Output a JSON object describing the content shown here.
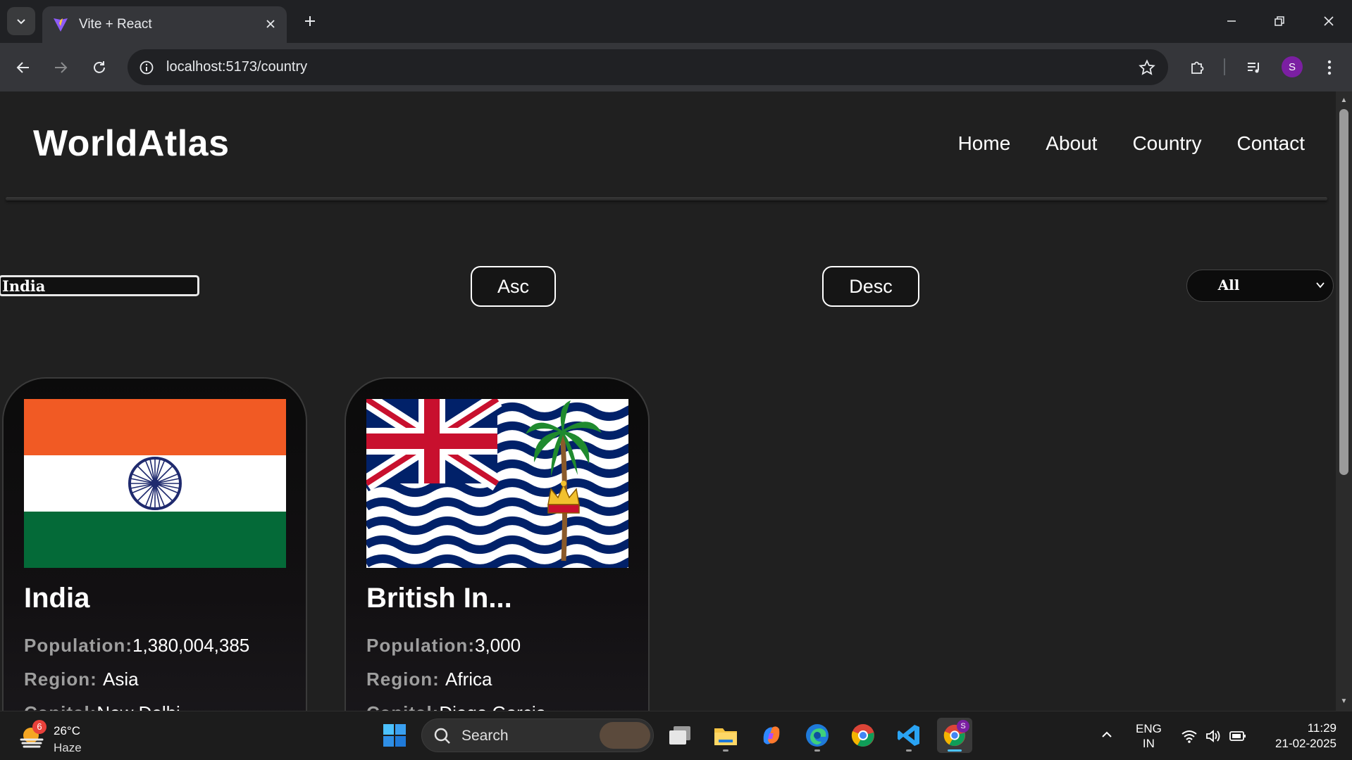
{
  "browser": {
    "tab_title": "Vite + React",
    "url": "localhost:5173/country",
    "profile_initial": "S"
  },
  "site": {
    "logo": "WorldAtlas",
    "nav": [
      "Home",
      "About",
      "Country",
      "Contact"
    ]
  },
  "controls": {
    "search_value": "India",
    "asc_label": "Asc",
    "desc_label": "Desc",
    "region_selected": "All"
  },
  "labels": {
    "population": "Population:",
    "region": "Region: ",
    "capital": "Capital:"
  },
  "countries": [
    {
      "name": "India",
      "flag": "india-flag",
      "population": "1,380,004,385",
      "region": "Asia",
      "capital": "New Delhi"
    },
    {
      "name": "British In...",
      "flag": "british-indian-ocean-territory-flag",
      "population": "3,000",
      "region": "Africa",
      "capital": "Diego Garcia"
    }
  ],
  "taskbar": {
    "weather_temp": "26°C",
    "weather_cond": "Haze",
    "weather_badge": "6",
    "search_label": "Search",
    "lang_line1": "ENG",
    "lang_line2": "IN",
    "time": "11:29",
    "date": "21-02-2025",
    "chrome_badge": "S"
  },
  "colors": {
    "page_bg": "#202020",
    "india_saffron": "#f15a24",
    "india_green": "#046a38",
    "chakra_navy": "#1f2a6e",
    "biot_blue": "#012169",
    "union_red": "#c8102e",
    "profile_purple": "#7b1fa2"
  }
}
